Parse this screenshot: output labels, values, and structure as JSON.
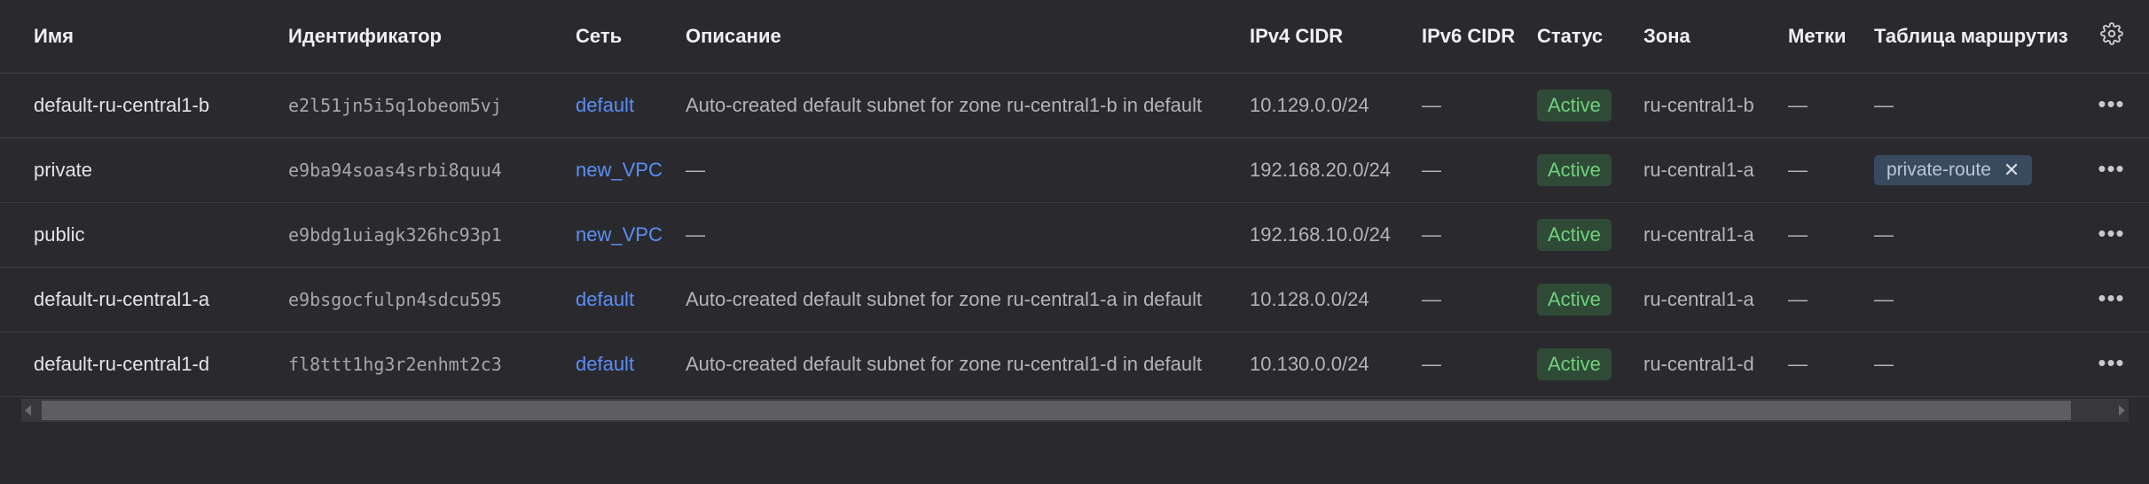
{
  "columns": {
    "name": "Имя",
    "id": "Идентификатор",
    "network": "Сеть",
    "description": "Описание",
    "ipv4": "IPv4 CIDR",
    "ipv6": "IPv6 CIDR",
    "status": "Статус",
    "zone": "Зона",
    "labels": "Метки",
    "route_table": "Таблица маршрутиз"
  },
  "rows": [
    {
      "name": "default-ru-central1-b",
      "id": "e2l51jn5i5q1obeom5vj",
      "network": "default",
      "description": "Auto-created default subnet for zone ru-central1-b in default",
      "ipv4": "10.129.0.0/24",
      "ipv6": "—",
      "status": "Active",
      "zone": "ru-central1-b",
      "labels": "—",
      "route_table": "—"
    },
    {
      "name": "private",
      "id": "e9ba94soas4srbi8quu4",
      "network": "new_VPC",
      "description": "—",
      "ipv4": "192.168.20.0/24",
      "ipv6": "—",
      "status": "Active",
      "zone": "ru-central1-a",
      "labels": "—",
      "route_table": "private-route"
    },
    {
      "name": "public",
      "id": "e9bdg1uiagk326hc93p1",
      "network": "new_VPC",
      "description": "—",
      "ipv4": "192.168.10.0/24",
      "ipv6": "—",
      "status": "Active",
      "zone": "ru-central1-a",
      "labels": "—",
      "route_table": "—"
    },
    {
      "name": "default-ru-central1-a",
      "id": "e9bsgocfulpn4sdcu595",
      "network": "default",
      "description": "Auto-created default subnet for zone ru-central1-a in default",
      "ipv4": "10.128.0.0/24",
      "ipv6": "—",
      "status": "Active",
      "zone": "ru-central1-a",
      "labels": "—",
      "route_table": "—"
    },
    {
      "name": "default-ru-central1-d",
      "id": "fl8ttt1hg3r2enhmt2c3",
      "network": "default",
      "description": "Auto-created default subnet for zone ru-central1-d in default",
      "ipv4": "10.130.0.0/24",
      "ipv6": "—",
      "status": "Active",
      "zone": "ru-central1-d",
      "labels": "—",
      "route_table": "—"
    }
  ],
  "icons": {
    "settings": "gear-icon",
    "row_actions": "more-horizontal-icon",
    "tag_remove": "close-icon"
  },
  "colors": {
    "background": "#2a2a2e",
    "link": "#5b8ef7",
    "status_active_text": "#6fd17c",
    "status_active_bg": "#2f4a37",
    "tag_bg": "#3a4a5e"
  }
}
